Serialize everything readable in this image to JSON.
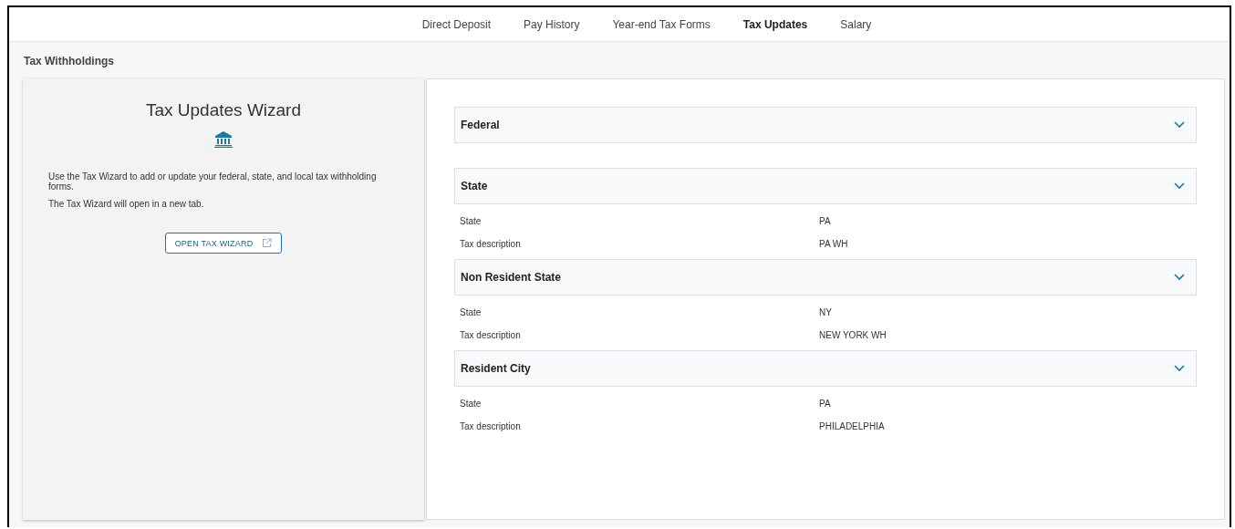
{
  "tabs": [
    {
      "label": "Direct Deposit",
      "selected": false
    },
    {
      "label": "Pay History",
      "selected": false
    },
    {
      "label": "Year-end Tax Forms",
      "selected": false
    },
    {
      "label": "Tax Updates",
      "selected": true
    },
    {
      "label": "Salary",
      "selected": false
    }
  ],
  "page_title": "Tax Withholdings",
  "wizard": {
    "title": "Tax Updates Wizard",
    "paragraphs": [
      "Use the Tax Wizard to add or update your federal, state, and local tax withholding forms.",
      "The Tax Wizard will open in a new tab."
    ],
    "button": "OPEN TAX WIZARD"
  },
  "sections": [
    {
      "title": "Federal"
    },
    {
      "title": "State",
      "fields": [
        {
          "label": "State",
          "value": "PA"
        },
        {
          "label": "Tax description",
          "value": "PA WH"
        }
      ]
    },
    {
      "title": "Non Resident State",
      "fields": [
        {
          "label": "State",
          "value": "NY"
        },
        {
          "label": "Tax description",
          "value": "NEW YORK WH"
        }
      ]
    },
    {
      "title": "Resident City",
      "fields": [
        {
          "label": "State",
          "value": "PA"
        },
        {
          "label": "Tax description",
          "value": "PHILADELPHIA"
        }
      ]
    }
  ]
}
